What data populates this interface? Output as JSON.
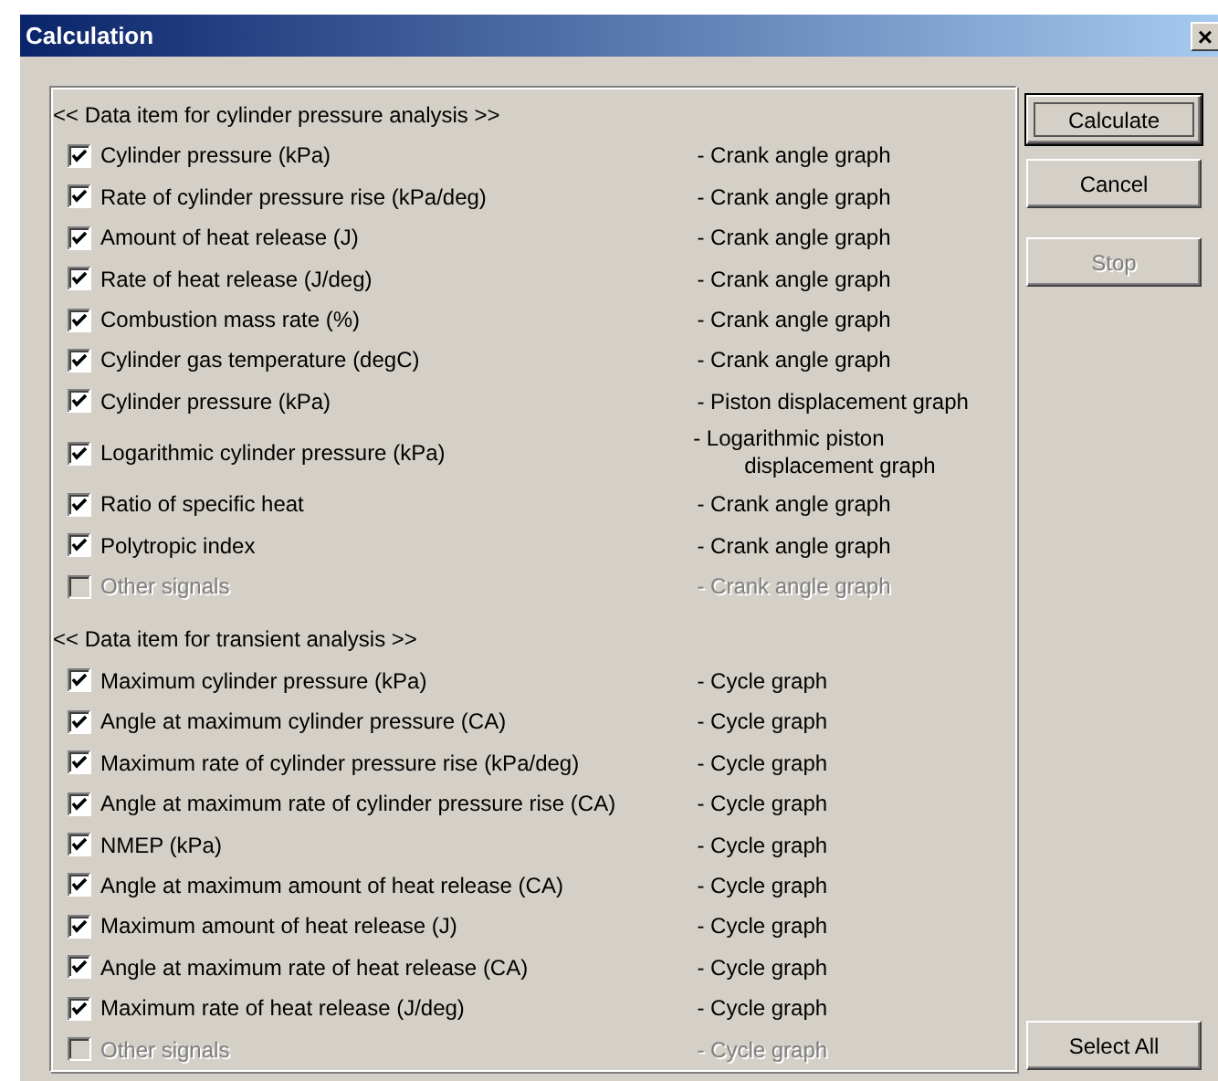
{
  "window": {
    "title": "Calculation",
    "close": "×"
  },
  "sections": [
    {
      "heading": "<< Data item for cylinder pressure analysis >>",
      "items": [
        {
          "label": "Cylinder pressure (kPa)",
          "graph": "- Crank angle graph",
          "checked": true,
          "disabled": false
        },
        {
          "label": "Rate of cylinder pressure rise (kPa/deg)",
          "graph": "- Crank angle graph",
          "checked": true,
          "disabled": false
        },
        {
          "label": "Amount of heat release (J)",
          "graph": "- Crank angle graph",
          "checked": true,
          "disabled": false
        },
        {
          "label": "Rate of heat release (J/deg)",
          "graph": "- Crank angle graph",
          "checked": true,
          "disabled": false
        },
        {
          "label": "Combustion mass rate (%)",
          "graph": "- Crank angle graph",
          "checked": true,
          "disabled": false
        },
        {
          "label": "Cylinder gas temperature (degC)",
          "graph": "- Crank angle graph",
          "checked": true,
          "disabled": false
        },
        {
          "label": "Cylinder pressure (kPa)",
          "graph": "- Piston displacement graph",
          "checked": true,
          "disabled": false
        },
        {
          "label": "Logarithmic cylinder pressure (kPa)",
          "graph": "- Logarithmic piston\ndisplacement graph",
          "checked": true,
          "disabled": false
        },
        {
          "label": "Ratio of specific heat",
          "graph": "- Crank angle graph",
          "checked": true,
          "disabled": false
        },
        {
          "label": "Polytropic index",
          "graph": "- Crank angle graph",
          "checked": true,
          "disabled": false
        },
        {
          "label": "Other signals",
          "graph": "- Crank angle graph",
          "checked": false,
          "disabled": true
        }
      ]
    },
    {
      "heading": "<< Data item for transient analysis >>",
      "items": [
        {
          "label": "Maximum cylinder pressure (kPa)",
          "graph": "- Cycle graph",
          "checked": true,
          "disabled": false
        },
        {
          "label": "Angle at maximum cylinder pressure (CA)",
          "graph": "- Cycle graph",
          "checked": true,
          "disabled": false
        },
        {
          "label": "Maximum rate of cylinder pressure rise (kPa/deg)",
          "graph": "- Cycle graph",
          "checked": true,
          "disabled": false
        },
        {
          "label": "Angle at maximum rate of cylinder pressure rise (CA)",
          "graph": "- Cycle graph",
          "checked": true,
          "disabled": false
        },
        {
          "label": "NMEP (kPa)",
          "graph": "- Cycle graph",
          "checked": true,
          "disabled": false
        },
        {
          "label": "Angle at maximum amount of heat release (CA)",
          "graph": "- Cycle graph",
          "checked": true,
          "disabled": false
        },
        {
          "label": "Maximum amount of heat release (J)",
          "graph": "- Cycle graph",
          "checked": true,
          "disabled": false
        },
        {
          "label": "Angle at maximum rate of heat release (CA)",
          "graph": "- Cycle graph",
          "checked": true,
          "disabled": false
        },
        {
          "label": "Maximum rate of heat release (J/deg)",
          "graph": "- Cycle graph",
          "checked": true,
          "disabled": false
        },
        {
          "label": "Other signals",
          "graph": "- Cycle graph",
          "checked": false,
          "disabled": true
        }
      ]
    }
  ],
  "buttons": [
    {
      "label": "Calculate",
      "disabled": false,
      "focused": true
    },
    {
      "label": "Cancel",
      "disabled": false,
      "focused": false
    },
    {
      "label": "Stop",
      "disabled": true,
      "focused": false
    }
  ],
  "select_all_button": {
    "label": "Select All",
    "disabled": false,
    "focused": false
  }
}
